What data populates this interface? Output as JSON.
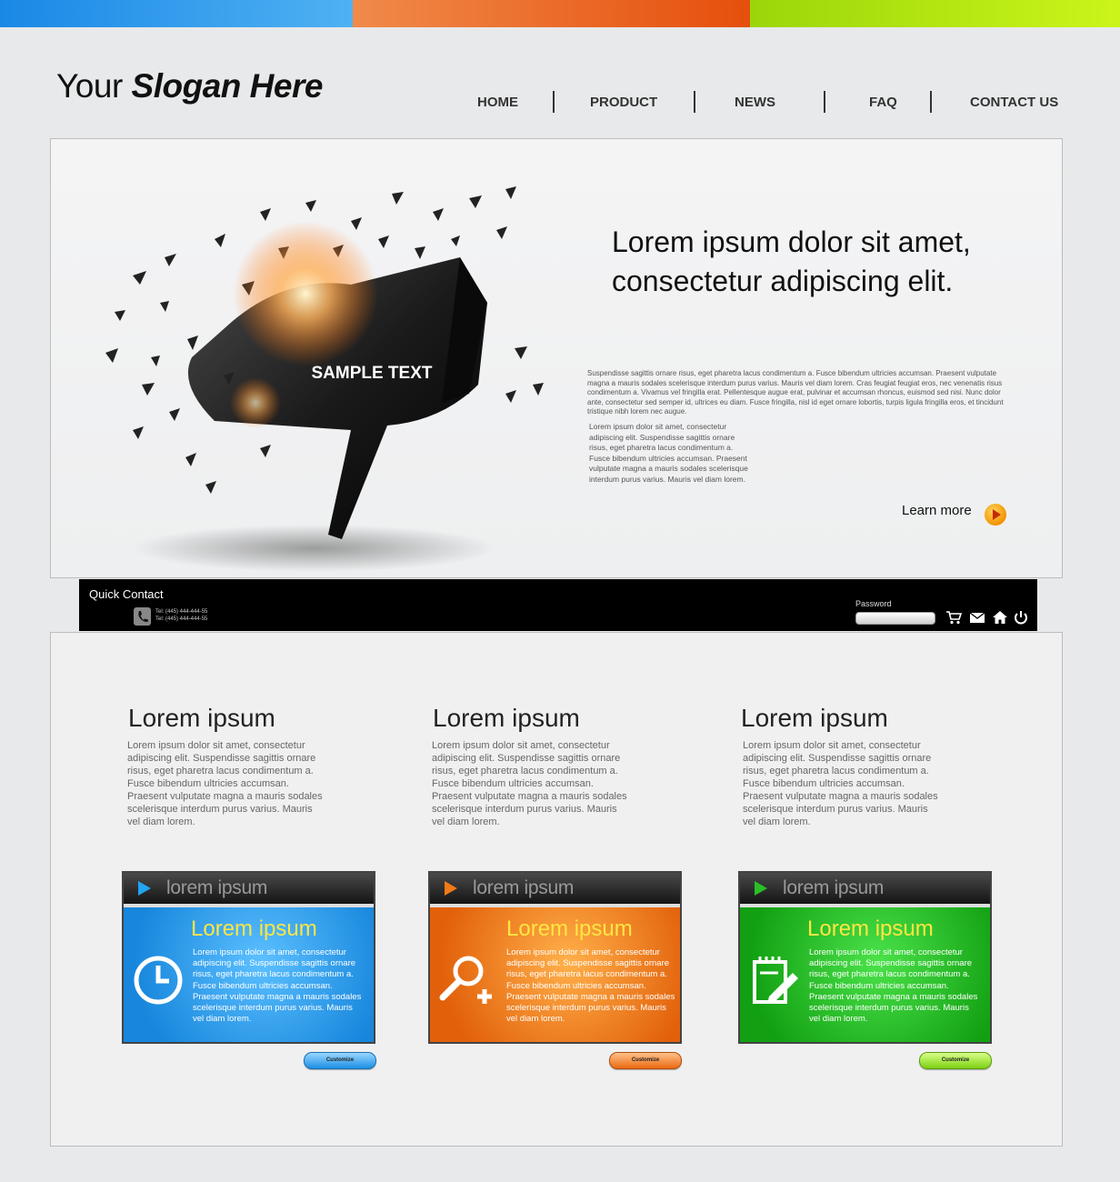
{
  "colors": {
    "blue": "#1a88e6",
    "orange": "#e8641a",
    "green": "#9bd60a",
    "yellow_title": "#ffe642"
  },
  "header": {
    "slogan_prefix": "Your",
    "slogan_strong": "Slogan Here"
  },
  "nav": {
    "items": [
      {
        "label": "HOME"
      },
      {
        "label": "PRODUCT"
      },
      {
        "label": "NEWS"
      },
      {
        "label": "FAQ"
      },
      {
        "label": "CONTACT US"
      }
    ]
  },
  "hero": {
    "art_label": "SAMPLE TEXT",
    "title": "Lorem ipsum dolor sit amet, consectetur adipiscing elit.",
    "paragraph1": "Suspendisse sagittis ornare risus, eget pharetra lacus condimentum a. Fusce bibendum ultricies accumsan. Praesent vulputate magna a mauris sodales scelerisque interdum purus varius. Mauris vel diam lorem. Cras feugiat feugiat eros, nec venenatis risus condimentum a. Vivamus vel fringilla erat. Pellentesque augue erat, pulvinar et accumsan rhoncus, euismod sed nisi. Nunc dolor ante, consectetur sed semper id, ultrices eu diam. Fusce fringilla, nisl id eget ornare lobortis, turpis ligula fringilla eros, et tincidunt tristique nibh lorem nec augue.",
    "paragraph2": "Lorem ipsum dolor sit amet, consectetur adipiscing elit. Suspendisse sagittis ornare risus, eget pharetra lacus condimentum a. Fusce bibendum ultricies accumsan. Praesent vulputate magna a mauris sodales scelerisque interdum purus varius. Mauris vel diam lorem.",
    "learn_more": "Learn more"
  },
  "quick_contact": {
    "title": "Quick Contact",
    "tel1": "Tel: (445) 444-444-55",
    "tel2": "Tel: (445) 444-444-55",
    "password_label": "Password",
    "icons": [
      "cart-icon",
      "mail-icon",
      "home-icon",
      "power-icon"
    ]
  },
  "columns": [
    {
      "title": "Lorem ipsum",
      "text": "Lorem ipsum dolor sit amet, consectetur adipiscing elit. Suspendisse sagittis ornare risus, eget pharetra lacus condimentum a. Fusce bibendum ultricies accumsan. Praesent vulputate magna a mauris sodales scelerisque interdum purus varius. Mauris vel diam lorem."
    },
    {
      "title": "Lorem ipsum",
      "text": "Lorem ipsum dolor sit amet, consectetur adipiscing elit. Suspendisse sagittis ornare risus, eget pharetra lacus condimentum a. Fusce bibendum ultricies accumsan. Praesent vulputate magna a mauris sodales scelerisque interdum purus varius. Mauris vel diam lorem."
    },
    {
      "title": "Lorem ipsum",
      "text": "Lorem ipsum dolor sit amet, consectetur adipiscing elit. Suspendisse sagittis ornare risus, eget pharetra lacus condimentum a. Fusce bibendum ultricies accumsan. Praesent vulputate magna a mauris sodales scelerisque interdum purus varius. Mauris vel diam lorem."
    }
  ],
  "cards": [
    {
      "header": "lorem ipsum",
      "title": "Lorem ipsum",
      "icon": "clock-icon",
      "button": "Customize",
      "color": "#1a9be6",
      "text": "Lorem ipsum dolor sit amet, consectetur adipiscing elit. Suspendisse sagittis ornare risus, eget pharetra lacus condimentum a. Fusce bibendum ultricies accumsan. Praesent vulputate magna a mauris sodales scelerisque interdum purus varius. Mauris vel diam lorem."
    },
    {
      "header": "lorem ipsum",
      "title": "Lorem ipsum",
      "icon": "zoom-in-icon",
      "button": "Customize",
      "color": "#ee7a10",
      "text": "Lorem ipsum dolor sit amet, consectetur adipiscing elit. Suspendisse sagittis ornare risus, eget pharetra lacus condimentum a. Fusce bibendum ultricies accumsan. Praesent vulputate magna a mauris sodales scelerisque interdum purus varius. Mauris vel diam lorem."
    },
    {
      "header": "lorem ipsum",
      "title": "Lorem ipsum",
      "icon": "notepad-pencil-icon",
      "button": "Customize",
      "color": "#1fb21a",
      "text": "Lorem ipsum dolor sit amet, consectetur adipiscing elit. Suspendisse sagittis ornare risus, eget pharetra lacus condimentum a. Fusce bibendum ultricies accumsan. Praesent vulputate magna a mauris sodales scelerisque interdum purus varius. Mauris vel diam lorem."
    }
  ]
}
